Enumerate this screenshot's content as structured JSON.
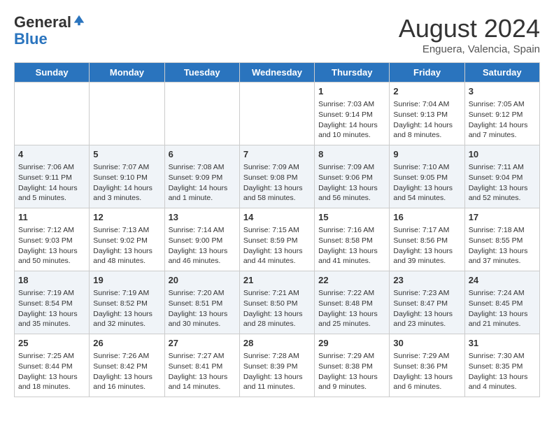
{
  "header": {
    "logo_line1": "General",
    "logo_line2": "Blue",
    "main_title": "August 2024",
    "subtitle": "Enguera, Valencia, Spain"
  },
  "days_of_week": [
    "Sunday",
    "Monday",
    "Tuesday",
    "Wednesday",
    "Thursday",
    "Friday",
    "Saturday"
  ],
  "weeks": [
    [
      {
        "day": "",
        "content": ""
      },
      {
        "day": "",
        "content": ""
      },
      {
        "day": "",
        "content": ""
      },
      {
        "day": "",
        "content": ""
      },
      {
        "day": "1",
        "content": "Sunrise: 7:03 AM\nSunset: 9:14 PM\nDaylight: 14 hours\nand 10 minutes."
      },
      {
        "day": "2",
        "content": "Sunrise: 7:04 AM\nSunset: 9:13 PM\nDaylight: 14 hours\nand 8 minutes."
      },
      {
        "day": "3",
        "content": "Sunrise: 7:05 AM\nSunset: 9:12 PM\nDaylight: 14 hours\nand 7 minutes."
      }
    ],
    [
      {
        "day": "4",
        "content": "Sunrise: 7:06 AM\nSunset: 9:11 PM\nDaylight: 14 hours\nand 5 minutes."
      },
      {
        "day": "5",
        "content": "Sunrise: 7:07 AM\nSunset: 9:10 PM\nDaylight: 14 hours\nand 3 minutes."
      },
      {
        "day": "6",
        "content": "Sunrise: 7:08 AM\nSunset: 9:09 PM\nDaylight: 14 hours\nand 1 minute."
      },
      {
        "day": "7",
        "content": "Sunrise: 7:09 AM\nSunset: 9:08 PM\nDaylight: 13 hours\nand 58 minutes."
      },
      {
        "day": "8",
        "content": "Sunrise: 7:09 AM\nSunset: 9:06 PM\nDaylight: 13 hours\nand 56 minutes."
      },
      {
        "day": "9",
        "content": "Sunrise: 7:10 AM\nSunset: 9:05 PM\nDaylight: 13 hours\nand 54 minutes."
      },
      {
        "day": "10",
        "content": "Sunrise: 7:11 AM\nSunset: 9:04 PM\nDaylight: 13 hours\nand 52 minutes."
      }
    ],
    [
      {
        "day": "11",
        "content": "Sunrise: 7:12 AM\nSunset: 9:03 PM\nDaylight: 13 hours\nand 50 minutes."
      },
      {
        "day": "12",
        "content": "Sunrise: 7:13 AM\nSunset: 9:02 PM\nDaylight: 13 hours\nand 48 minutes."
      },
      {
        "day": "13",
        "content": "Sunrise: 7:14 AM\nSunset: 9:00 PM\nDaylight: 13 hours\nand 46 minutes."
      },
      {
        "day": "14",
        "content": "Sunrise: 7:15 AM\nSunset: 8:59 PM\nDaylight: 13 hours\nand 44 minutes."
      },
      {
        "day": "15",
        "content": "Sunrise: 7:16 AM\nSunset: 8:58 PM\nDaylight: 13 hours\nand 41 minutes."
      },
      {
        "day": "16",
        "content": "Sunrise: 7:17 AM\nSunset: 8:56 PM\nDaylight: 13 hours\nand 39 minutes."
      },
      {
        "day": "17",
        "content": "Sunrise: 7:18 AM\nSunset: 8:55 PM\nDaylight: 13 hours\nand 37 minutes."
      }
    ],
    [
      {
        "day": "18",
        "content": "Sunrise: 7:19 AM\nSunset: 8:54 PM\nDaylight: 13 hours\nand 35 minutes."
      },
      {
        "day": "19",
        "content": "Sunrise: 7:19 AM\nSunset: 8:52 PM\nDaylight: 13 hours\nand 32 minutes."
      },
      {
        "day": "20",
        "content": "Sunrise: 7:20 AM\nSunset: 8:51 PM\nDaylight: 13 hours\nand 30 minutes."
      },
      {
        "day": "21",
        "content": "Sunrise: 7:21 AM\nSunset: 8:50 PM\nDaylight: 13 hours\nand 28 minutes."
      },
      {
        "day": "22",
        "content": "Sunrise: 7:22 AM\nSunset: 8:48 PM\nDaylight: 13 hours\nand 25 minutes."
      },
      {
        "day": "23",
        "content": "Sunrise: 7:23 AM\nSunset: 8:47 PM\nDaylight: 13 hours\nand 23 minutes."
      },
      {
        "day": "24",
        "content": "Sunrise: 7:24 AM\nSunset: 8:45 PM\nDaylight: 13 hours\nand 21 minutes."
      }
    ],
    [
      {
        "day": "25",
        "content": "Sunrise: 7:25 AM\nSunset: 8:44 PM\nDaylight: 13 hours\nand 18 minutes."
      },
      {
        "day": "26",
        "content": "Sunrise: 7:26 AM\nSunset: 8:42 PM\nDaylight: 13 hours\nand 16 minutes."
      },
      {
        "day": "27",
        "content": "Sunrise: 7:27 AM\nSunset: 8:41 PM\nDaylight: 13 hours\nand 14 minutes."
      },
      {
        "day": "28",
        "content": "Sunrise: 7:28 AM\nSunset: 8:39 PM\nDaylight: 13 hours\nand 11 minutes."
      },
      {
        "day": "29",
        "content": "Sunrise: 7:29 AM\nSunset: 8:38 PM\nDaylight: 13 hours\nand 9 minutes."
      },
      {
        "day": "30",
        "content": "Sunrise: 7:29 AM\nSunset: 8:36 PM\nDaylight: 13 hours\nand 6 minutes."
      },
      {
        "day": "31",
        "content": "Sunrise: 7:30 AM\nSunset: 8:35 PM\nDaylight: 13 hours\nand 4 minutes."
      }
    ]
  ]
}
